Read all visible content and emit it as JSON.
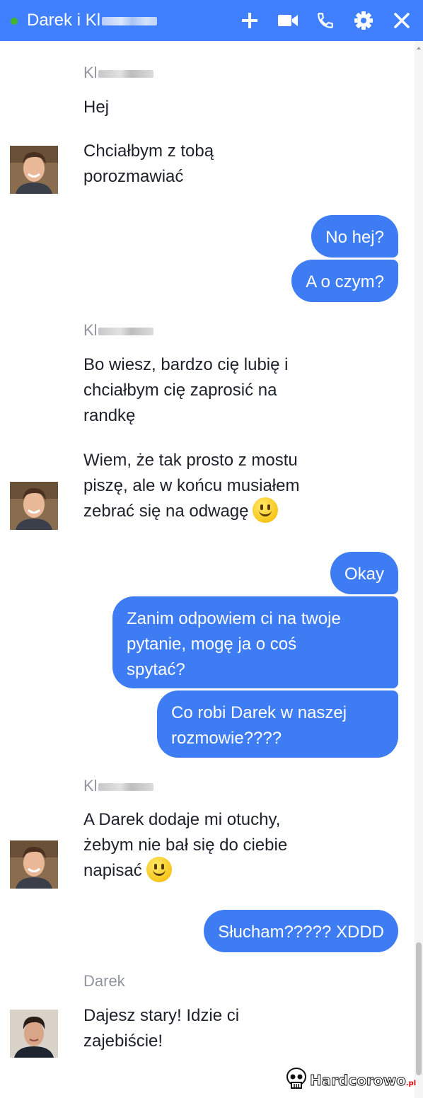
{
  "header": {
    "title_visible": "Darek i Kl",
    "title_obscured": "(name blurred)",
    "accent_color": "#4080ff",
    "status_color": "#42b72a",
    "icons": [
      "plus-icon",
      "video-icon",
      "phone-icon",
      "gear-icon",
      "close-icon"
    ]
  },
  "messages": {
    "sender1": "Kl",
    "m1": "Hej",
    "m2": "Chciałbym z tobą\nporozmawiać",
    "o1": "No hej?",
    "o2": "A o czym?",
    "sender2": "Kl",
    "m3": "Bo wiesz, bardzo cię lubię i\nchciałbym cię zaprosić na\nrandkę",
    "m4": "Wiem, że tak prosto z mostu\npiszę, ale w końcu musiałem\nzebrać się na odwagę",
    "o3": "Okay",
    "o4": "Zanim odpowiem ci na twoje\npytanie, mogę ja o coś\nspytać?",
    "o5": "Co robi Darek w naszej\nrozmowie????",
    "sender3": "Kl",
    "m5": "A Darek dodaje mi otuchy,\nżebym nie bał się do ciebie\nnapisać",
    "o6": "Słucham????? XDDD",
    "sender4": "Darek",
    "m6": "Dajesz stary! Idzie ci\nzajebiście!"
  },
  "outgoing_color": "#3d7cf2",
  "watermark": {
    "text": "Hardcorowo",
    "suffix": ".pl"
  }
}
